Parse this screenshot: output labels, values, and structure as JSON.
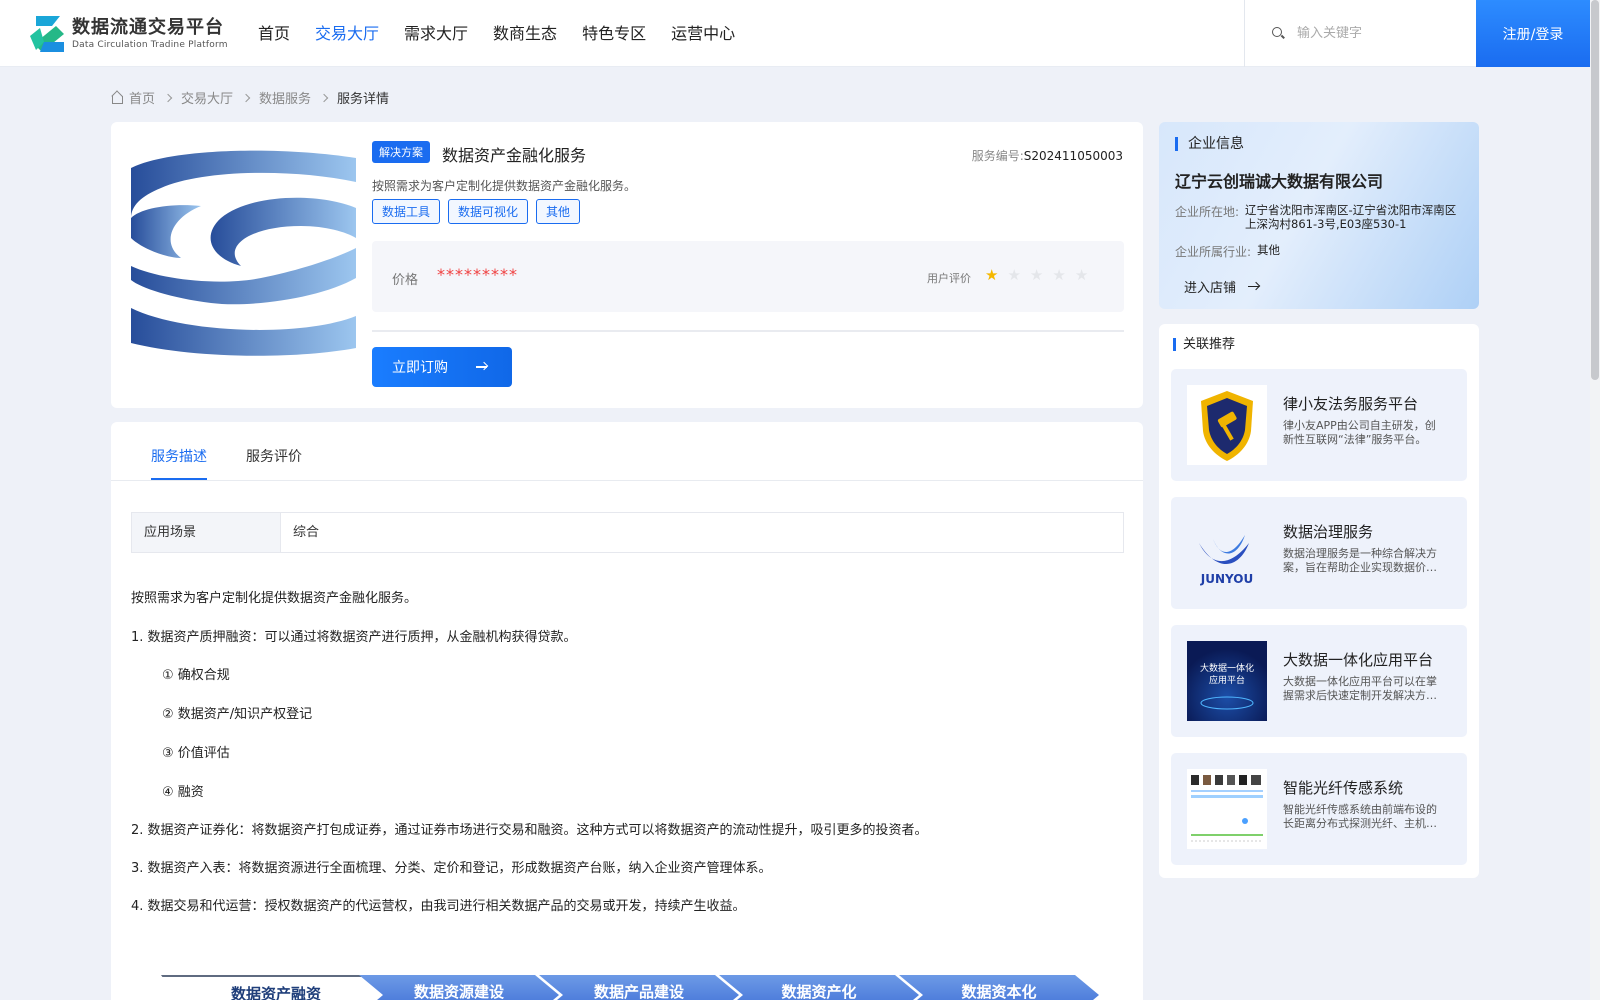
{
  "header": {
    "logo_title": "数据流通交易平台",
    "logo_sub": "Data Circulation Tradine Platform",
    "nav": [
      "首页",
      "交易大厅",
      "需求大厅",
      "数商生态",
      "特色专区",
      "运营中心"
    ],
    "active_nav": "交易大厅",
    "search_placeholder": "输入关键字",
    "login_label": "注册/登录"
  },
  "breadcrumb": [
    "首页",
    "交易大厅",
    "数据服务",
    "服务详情"
  ],
  "product": {
    "badge": "解决方案",
    "title": "数据资产金融化服务",
    "service_no_label": "服务编号:",
    "service_no": "S202411050003",
    "description": "按照需求为客户定制化提供数据资产金融化服务。",
    "tags": [
      "数据工具",
      "数据可视化",
      "其他"
    ],
    "price_label": "价格",
    "price_value": "*********",
    "rating_label": "用户评价",
    "rating": 1,
    "rating_max": 5,
    "buy_label": "立即订购",
    "colors": {
      "accent": "#1a6cf0",
      "price": "#f04040",
      "star": "#f5b800"
    }
  },
  "tabs": {
    "desc": "服务描述",
    "review": "服务评价",
    "active": "服务描述"
  },
  "detail": {
    "scene_key": "应用场景",
    "scene_value": "综合",
    "intro": "按照需求为客户定制化提供数据资产金融化服务。",
    "p1": "1. 数据资产质押融资：可以通过将数据资产进行质押，从金融机构获得贷款。",
    "sub1": "①  确权合规",
    "sub2": "②  数据资产/知识产权登记",
    "sub3": "③  价值评估",
    "sub4": "④  融资",
    "p2": "2. 数据资产证券化：将数据资产打包成证券，通过证券市场进行交易和融资。这种方式可以将数据资产的流动性提升，吸引更多的投资者。",
    "p3": "3. 数据资产入表：将数据资源进行全面梳理、分类、定价和登记，形成数据资产台账，纳入企业资产管理体系。",
    "p4": "4. 数据交易和代运营：授权数据资产的代运营权，由我司进行相关数据产品的交易或开发，持续产生收益。",
    "steps": [
      "数据资产融资",
      "数据资源建设",
      "数据产品建设",
      "数据资产化",
      "数据资本化"
    ]
  },
  "company": {
    "heading": "企业信息",
    "name": "辽宁云创瑞诚大数据有限公司",
    "location_label": "企业所在地:",
    "location": "辽宁省沈阳市浑南区-辽宁省沈阳市浑南区上深沟村861-3号,E03座530-1",
    "industry_label": "企业所属行业:",
    "industry": "其他",
    "enter_label": "进入店铺"
  },
  "recommend": {
    "heading": "关联推荐",
    "items": [
      {
        "title": "律小友法务服务平台",
        "desc": "律小友APP由公司自主研发，创新性互联网“法律”服务平台。",
        "thumb": "shield-icon"
      },
      {
        "title": "数据治理服务",
        "desc": "数据治理服务是一种综合解决方案，旨在帮助企业实现数据价值。",
        "thumb": "junyou-logo",
        "thumb_text": "JUNYOU"
      },
      {
        "title": "大数据一体化应用平台",
        "desc": "大数据一体化应用平台可以在掌握需求后快速定制开发解决方案。",
        "thumb": "platform-banner",
        "thumb_text_1": "大数据一体化",
        "thumb_text_2": "应用平台"
      },
      {
        "title": "智能光纤传感系统",
        "desc": "智能光纤传感系统由前端布设的长距离分布式探测光纤、主机组成。",
        "thumb": "dashboard-screenshot"
      }
    ]
  }
}
